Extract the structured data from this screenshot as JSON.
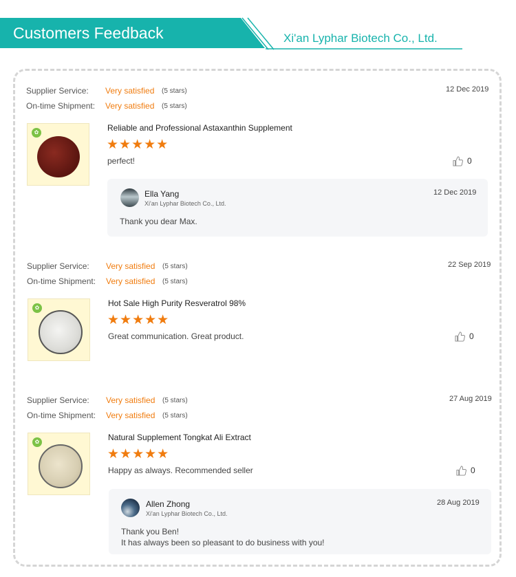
{
  "header": {
    "title": "Customers Feedback",
    "company": "Xi'an Lyphar Biotech Co., Ltd.",
    "accent_color": "#17b3ac"
  },
  "labels": {
    "supplier_service": "Supplier Service:",
    "ontime_shipment": "On-time Shipment:"
  },
  "reviews": [
    {
      "supplier_value": "Very satisfied",
      "supplier_stars": "(5 stars)",
      "shipment_value": "Very satisfied",
      "shipment_stars": "(5 stars)",
      "date": "12 Dec 2019",
      "product_title": "Reliable and Professional Astaxanthin Supplement",
      "rating": 5,
      "stars_text": "★★★★★",
      "comment": "perfect!",
      "likes": "0",
      "product_image": "red-powder",
      "reply": {
        "name": "Ella Yang",
        "company": "Xi'an Lyphar Biotech Co., Ltd.",
        "date": "12 Dec 2019",
        "lines": [
          "Thank you dear Max."
        ]
      }
    },
    {
      "supplier_value": "Very satisfied",
      "supplier_stars": "(5 stars)",
      "shipment_value": "Very satisfied",
      "shipment_stars": "(5 stars)",
      "date": "22 Sep 2019",
      "product_title": "Hot Sale High Purity Resveratrol 98%",
      "rating": 5,
      "stars_text": "★★★★★",
      "comment": "Great communication. Great product.",
      "likes": "0",
      "product_image": "white-powder"
    },
    {
      "supplier_value": "Very satisfied",
      "supplier_stars": "(5 stars)",
      "shipment_value": "Very satisfied",
      "shipment_stars": "(5 stars)",
      "date": "27 Aug 2019",
      "product_title": "Natural Supplement Tongkat Ali Extract",
      "rating": 5,
      "stars_text": "★★★★★",
      "comment": "Happy as always. Recommended seller",
      "likes": "0",
      "product_image": "beige-powder",
      "reply": {
        "name": "Allen Zhong",
        "company": "Xi'an Lyphar Biotech Co., Ltd.",
        "date": "28 Aug 2019",
        "lines": [
          "Thank you Ben!",
          "It has always been so pleasant to do business with you!"
        ]
      }
    }
  ]
}
